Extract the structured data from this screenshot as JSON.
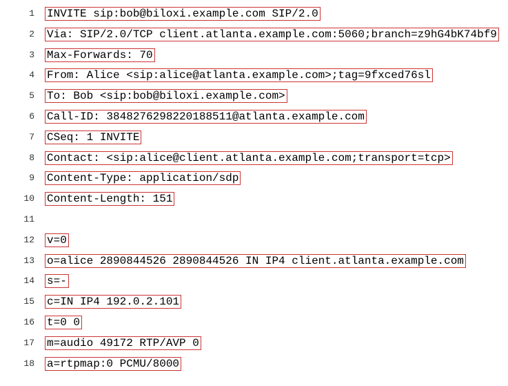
{
  "lines": [
    {
      "n": "1",
      "text": "INVITE sip:bob@biloxi.example.com SIP/2.0",
      "highlight": true
    },
    {
      "n": "2",
      "text": "Via: SIP/2.0/TCP client.atlanta.example.com:5060;branch=z9hG4bK74bf9",
      "highlight": true
    },
    {
      "n": "3",
      "text": "Max-Forwards: 70",
      "highlight": true
    },
    {
      "n": "4",
      "text": "From: Alice <sip:alice@atlanta.example.com>;tag=9fxced76sl",
      "highlight": true
    },
    {
      "n": "5",
      "text": "To: Bob <sip:bob@biloxi.example.com>",
      "highlight": true
    },
    {
      "n": "6",
      "text": "Call-ID: 3848276298220188511@atlanta.example.com",
      "highlight": true
    },
    {
      "n": "7",
      "text": "CSeq: 1 INVITE",
      "highlight": true
    },
    {
      "n": "8",
      "text": "Contact: <sip:alice@client.atlanta.example.com;transport=tcp>",
      "highlight": true
    },
    {
      "n": "9",
      "text": "Content-Type: application/sdp",
      "highlight": true
    },
    {
      "n": "10",
      "text": "Content-Length: 151",
      "highlight": true
    },
    {
      "n": "11",
      "text": "",
      "highlight": false
    },
    {
      "n": "12",
      "text": "v=0",
      "highlight": true
    },
    {
      "n": "13",
      "text": "o=alice 2890844526 2890844526 IN IP4 client.atlanta.example.com",
      "highlight": true
    },
    {
      "n": "14",
      "text": "s=-",
      "highlight": true
    },
    {
      "n": "15",
      "text": "c=IN IP4 192.0.2.101",
      "highlight": true
    },
    {
      "n": "16",
      "text": "t=0 0",
      "highlight": true
    },
    {
      "n": "17",
      "text": "m=audio 49172 RTP/AVP 0",
      "highlight": true
    },
    {
      "n": "18",
      "text": "a=rtpmap:0 PCMU/8000",
      "highlight": true
    }
  ]
}
